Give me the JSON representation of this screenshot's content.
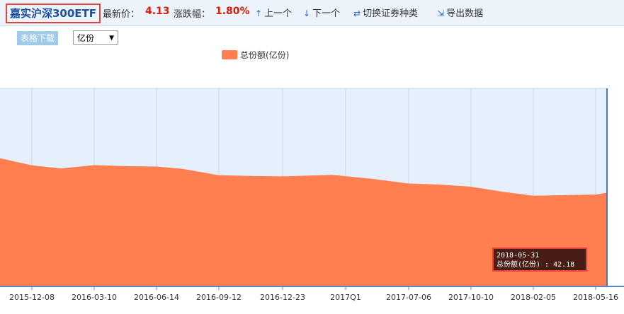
{
  "header": {
    "fund_name": "嘉实沪深300ETF",
    "latest_price_label": "最新价：",
    "latest_price_value": "4.13",
    "change_label": "涨跌幅：",
    "change_value": "1.80%",
    "prev_label": "上一个",
    "next_label": "下一个",
    "switch_label": "切换证券种类",
    "export_label": "导出数据"
  },
  "controls": {
    "download_label": "表格下载",
    "unit_selected": "亿份"
  },
  "tooltip": {
    "date": "2018-05-31",
    "text": "总份额(亿份) : 42.18"
  },
  "colors": {
    "series": "#ff7f50",
    "brand_blue": "#1b4f9c",
    "red_value": "#d81e06",
    "highlight_border": "#e8413a"
  },
  "chart_data": {
    "type": "area",
    "x_ticks": [
      "2015-12-08",
      "2016-03-10",
      "2016-06-14",
      "2016-09-12",
      "2016-12-23",
      "2017Q1",
      "2017-07-06",
      "2017-10-10",
      "2018-02-05",
      "2018-05-16"
    ],
    "series": [
      {
        "name": "总份额(亿份)",
        "x": [
          "2015-10-16",
          "2015-12-08",
          "2016-01-20",
          "2016-03-10",
          "2016-04-25",
          "2016-06-14",
          "2016-07-20",
          "2016-09-12",
          "2016-11-10",
          "2016-12-23",
          "2017-03-10",
          "2017-05-10",
          "2017-07-06",
          "2017-08-20",
          "2017-10-10",
          "2017-12-10",
          "2018-02-05",
          "2018-03-20",
          "2018-05-16",
          "2018-05-31"
        ],
        "values": [
          64.6,
          61.0,
          59.4,
          61.1,
          60.6,
          60.4,
          59.3,
          56.0,
          55.6,
          55.4,
          56.2,
          54.2,
          51.8,
          51.3,
          50.2,
          47.6,
          45.6,
          45.9,
          46.2,
          47.0
        ]
      }
    ],
    "ylim": [
      0,
      100
    ],
    "grid": true,
    "legend_position": "top"
  }
}
